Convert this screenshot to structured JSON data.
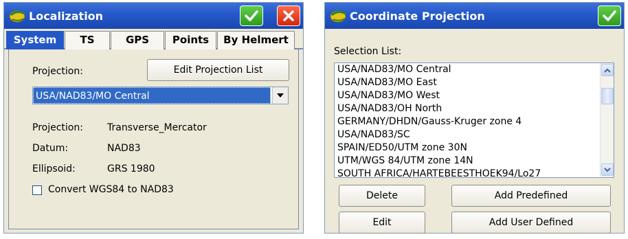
{
  "localization": {
    "title": "Localization",
    "tabs": [
      "System",
      "TS",
      "GPS",
      "Points",
      "By Helmert"
    ],
    "projection_label": "Projection:",
    "edit_projection_list_label": "Edit Projection List",
    "selected_projection": "USA/NAD83/MO Central",
    "details": [
      {
        "label": "Projection:",
        "value": "Transverse_Mercator"
      },
      {
        "label": "Datum:",
        "value": "NAD83"
      },
      {
        "label": "Ellipsoid:",
        "value": "GRS 1980"
      }
    ],
    "convert_checkbox_label": "Convert WGS84 to NAD83",
    "convert_checked": false
  },
  "coordinate_projection": {
    "title": "Coordinate Projection",
    "selection_list_label": "Selection List:",
    "items": [
      "USA/NAD83/MO Central",
      "USA/NAD83/MO East",
      "USA/NAD83/MO West",
      "USA/NAD83/OH North",
      "GERMANY/DHDN/Gauss-Kruger zone 4",
      "USA/NAD83/SC",
      "SPAIN/ED50/UTM zone 30N",
      "UTM/WGS 84/UTM zone 14N",
      "SOUTH AFRICA/HARTEBEESTHOEK94/Lo27"
    ],
    "buttons": {
      "delete": "Delete",
      "add_predefined": "Add Predefined",
      "edit": "Edit",
      "add_user_defined": "Add User Defined"
    }
  },
  "colors": {
    "titlebar": "#2458c9",
    "selection": "#3169c6",
    "ok_green": "#2f9a1f",
    "close_red": "#d3250f",
    "panel_bg": "#ece9d8"
  }
}
